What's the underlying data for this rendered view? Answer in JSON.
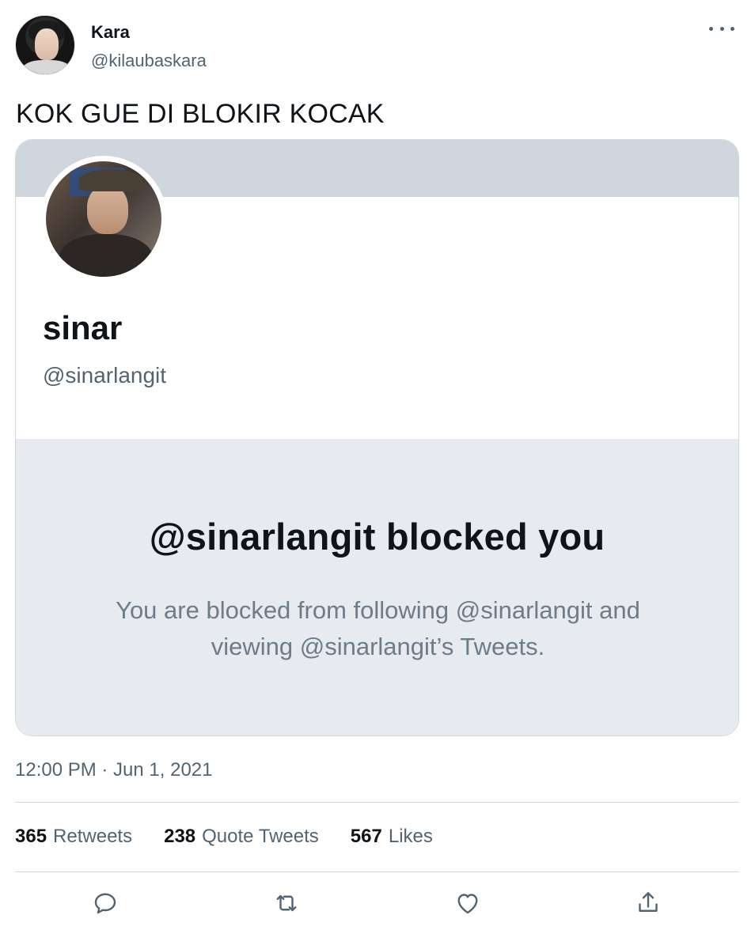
{
  "author": {
    "display_name": "Kara",
    "handle": "@kilaubaskara"
  },
  "tweet": {
    "text": "KOK GUE DI BLOKIR KOCAK",
    "timestamp": "12:00 PM · Jun 1, 2021"
  },
  "embedded_profile": {
    "name": "sinar",
    "handle": "@sinarlangit",
    "blocked_title": "@sinarlangit blocked you",
    "blocked_description": "You are blocked from following @sinarlangit and viewing @sinarlangit’s Tweets."
  },
  "stats": {
    "retweets_count": "365",
    "retweets_label": "Retweets",
    "quote_tweets_count": "238",
    "quote_tweets_label": "Quote Tweets",
    "likes_count": "567",
    "likes_label": "Likes"
  },
  "icons": {
    "more": "more-horizontal-icon",
    "reply": "reply-icon",
    "retweet": "retweet-icon",
    "like": "like-heart-icon",
    "share": "share-icon"
  },
  "colors": {
    "text_primary": "#0f1419",
    "text_secondary": "#536471",
    "border": "#cfd9de",
    "banner": "#cfd6de",
    "blocked_panel": "#e7ebef"
  }
}
